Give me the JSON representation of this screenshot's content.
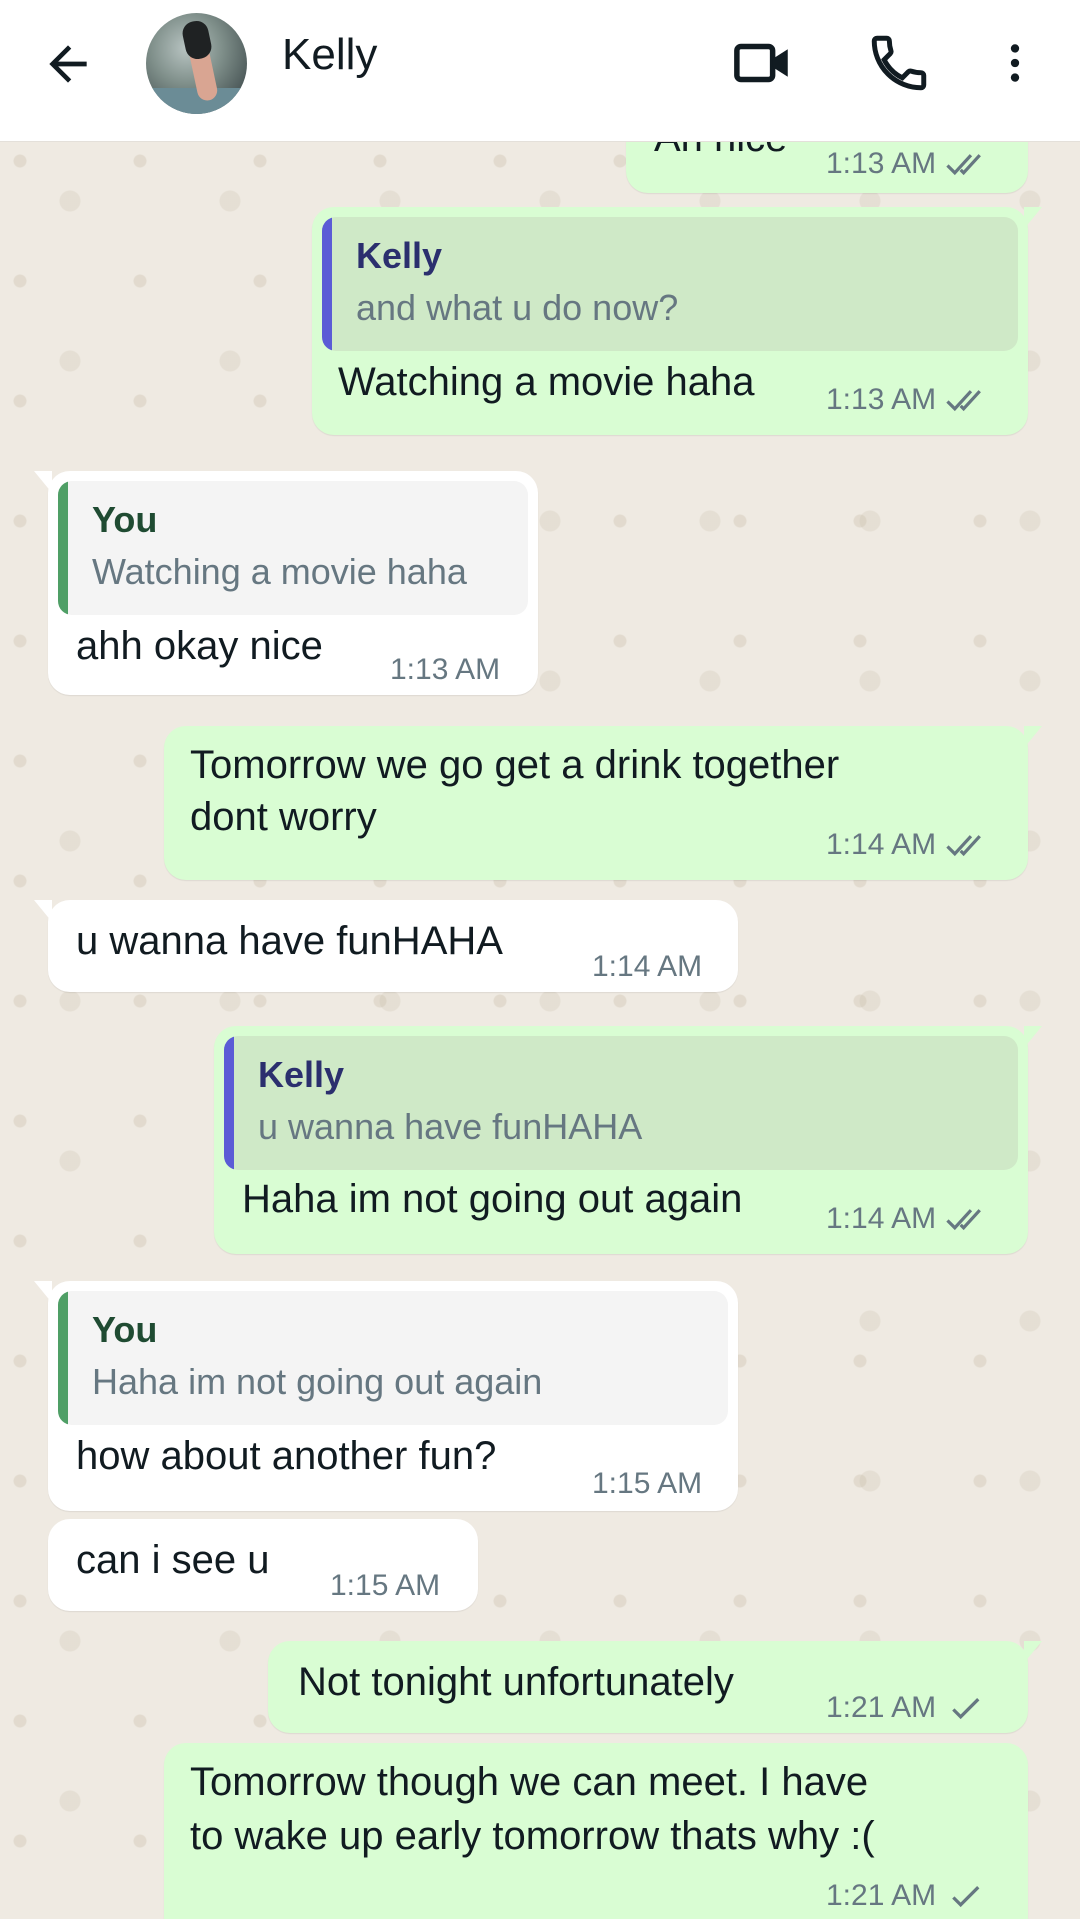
{
  "header": {
    "contact_name": "Kelly",
    "icons": [
      "back-arrow-icon",
      "video-call-icon",
      "phone-icon",
      "more-options-icon"
    ]
  },
  "messages": [
    {
      "dir": "out",
      "text": "Ah nice",
      "time": "1:13 AM",
      "status": "read"
    },
    {
      "dir": "out",
      "quote": {
        "name": "Kelly",
        "text": "and what u do now?"
      },
      "text": "Watching a movie haha",
      "time": "1:13 AM",
      "status": "read"
    },
    {
      "dir": "in",
      "quote": {
        "name": "You",
        "text": "Watching a movie haha"
      },
      "text": "ahh okay nice",
      "time": "1:13 AM"
    },
    {
      "dir": "out",
      "text_line1": "Tomorrow we go get a drink together",
      "text_line2": "dont worry",
      "time": "1:14 AM",
      "status": "read"
    },
    {
      "dir": "in",
      "text": "u wanna have funHAHA",
      "time": "1:14 AM"
    },
    {
      "dir": "out",
      "quote": {
        "name": "Kelly",
        "text": "u wanna have funHAHA"
      },
      "text": "Haha im not going out again",
      "time": "1:14 AM",
      "status": "read"
    },
    {
      "dir": "in",
      "quote": {
        "name": "You",
        "text": "Haha im not going out again"
      },
      "text": "how about another fun?",
      "time": "1:15 AM"
    },
    {
      "dir": "in",
      "text": "can i see u",
      "time": "1:15 AM"
    },
    {
      "dir": "out",
      "text": "Not tonight unfortunately",
      "time": "1:21 AM",
      "status": "sent"
    },
    {
      "dir": "out",
      "text_line1": "Tomorrow though we can meet. I have",
      "text_line2": "to wake up early tomorrow thats why :(",
      "time": "1:21 AM",
      "status": "sent"
    }
  ],
  "colors": {
    "outgoing_bubble": "#d9fdd3",
    "incoming_bubble": "#ffffff",
    "chat_background": "#efeae2",
    "read_tick": "#667781",
    "quote_bar_kelly": "#5b5bd6",
    "quote_bar_you": "#4f9f66"
  }
}
